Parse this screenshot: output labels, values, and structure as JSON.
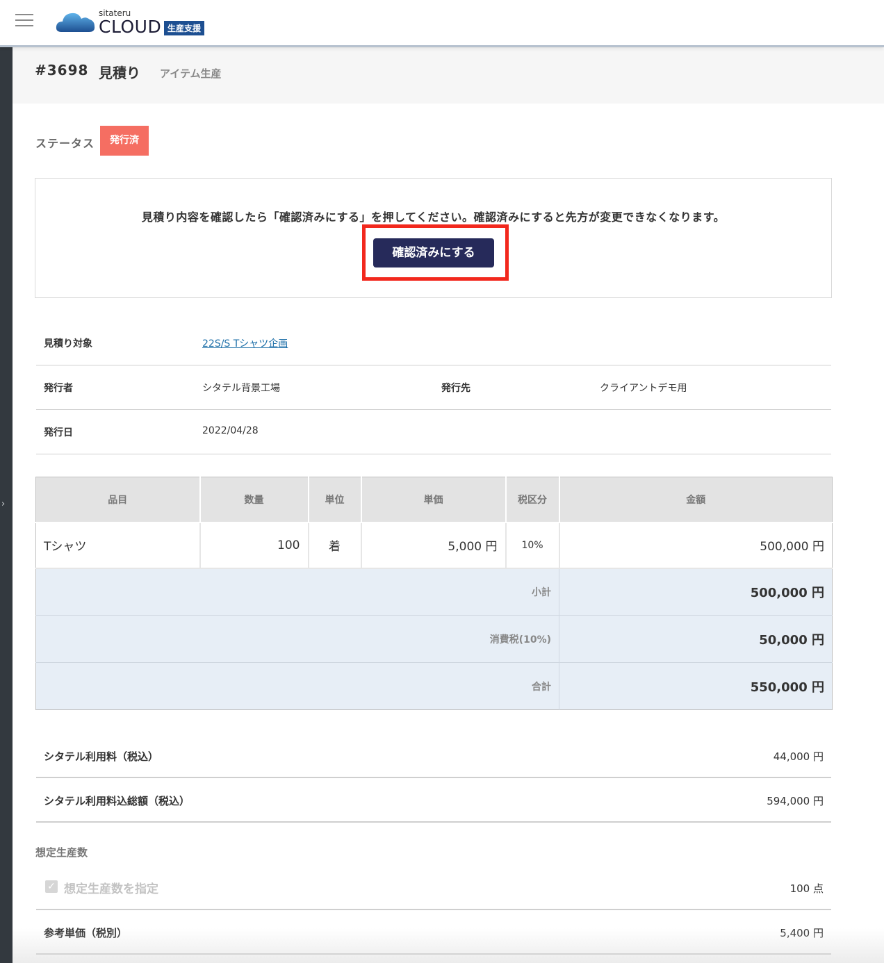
{
  "header": {
    "logo_small": "sitateru",
    "logo_big": "CLOUD",
    "logo_badge": "生産支援"
  },
  "page": {
    "doc_no": "#3698",
    "title": "見積り",
    "subtitle": "アイテム生産"
  },
  "status": {
    "label": "ステータス",
    "value": "発行済",
    "color": "#f56e62"
  },
  "confirm": {
    "message": "見積り内容を確認したら「確認済みにする」を押してください。確認済みにすると先方が変更できなくなります。",
    "button_label": "確認済みにする",
    "button_color": "#262a5a",
    "highlight_color": "#f2281d"
  },
  "info": {
    "target_label": "見積り対象",
    "target_value": "22S/S Tシャツ企画",
    "issuer_label": "発行者",
    "issuer_value": "シタテル背景工場",
    "recipient_label": "発行先",
    "recipient_value": "クライアントデモ用",
    "date_label": "発行日",
    "date_value": "2022/04/28"
  },
  "table": {
    "headers": {
      "item": "品目",
      "qty": "数量",
      "unit": "単位",
      "price": "単価",
      "tax": "税区分",
      "amount": "金額"
    },
    "row": {
      "item": "Tシャツ",
      "qty": "100",
      "unit": "着",
      "price": "5,000 円",
      "tax": "10%",
      "amount": "500,000 円"
    },
    "subtotal_label": "小計",
    "subtotal_value": "500,000 円",
    "tax_label": "消費税(10%)",
    "tax_value": "50,000 円",
    "total_label": "合計",
    "total_value": "550,000 円"
  },
  "fees": {
    "fee_label": "シタテル利用料（税込）",
    "fee_value": "44,000 円",
    "fee_total_label": "シタテル利用料込総額（税込）",
    "fee_total_value": "594,000 円"
  },
  "production": {
    "section_label": "想定生産数",
    "checkbox_label": "想定生産数を指定",
    "checkbox_checked": true,
    "quantity_value": "100 点",
    "ref_price_label": "参考単価（税別）",
    "ref_price_value": "5,400 円"
  }
}
